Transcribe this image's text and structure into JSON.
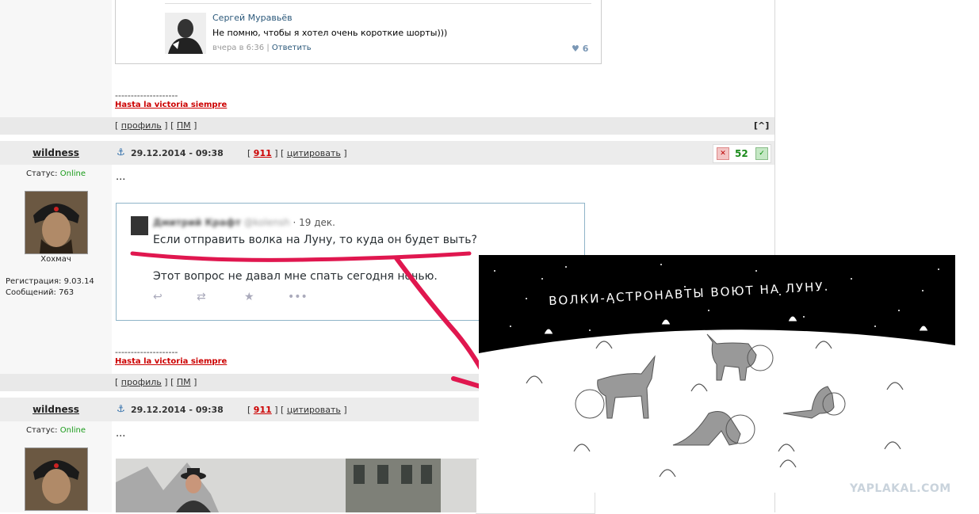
{
  "comment": {
    "author": "Сергей Муравьёв",
    "text": "Не помню, чтобы я хотел очень короткие шорты)))",
    "time": "вчера в 6:36",
    "separator": "|",
    "reply": "Ответить",
    "likes": "6"
  },
  "signature": {
    "line": "--------------------",
    "motto": "Hasta la victoria siempre"
  },
  "footer": {
    "profile": "профиль",
    "pm": "ПМ",
    "top": "[^]"
  },
  "post1": {
    "username": "wildness",
    "date": "29.12.2014 - 09:38",
    "number": "911",
    "quote": "цитировать",
    "status_label": "Статус:",
    "status_value": "Online",
    "rank": "Хохмач",
    "reg_label": "Регистрация:",
    "reg_value": "9.03.14",
    "posts_label": "Сообщений:",
    "posts_value": "763",
    "body": "...",
    "rating": "52"
  },
  "tweet": {
    "name": "Дмитрий Крафт",
    "handle": "@kolensh",
    "date": "· 19 дек.",
    "line1": "Если отправить волка на Луну, то куда он будет выть?",
    "line2": "Этот вопрос не давал мне спать сегодня ночью."
  },
  "post2": {
    "username": "wildness",
    "date": "29.12.2014 - 09:38",
    "number": "911",
    "quote": "цитировать",
    "status_label": "Статус:",
    "status_value": "Online",
    "body": "..."
  },
  "comic": {
    "caption": "ВОЛКИ-АСТРОНАВТЫ ВОЮТ НА ЛУНУ."
  },
  "watermark": "YAPLAKAL.COM",
  "colors": {
    "accent_red": "#cc0000",
    "online_green": "#1a9b1a",
    "rating_green": "#1a8a1a",
    "annotation": "#e0174f"
  }
}
